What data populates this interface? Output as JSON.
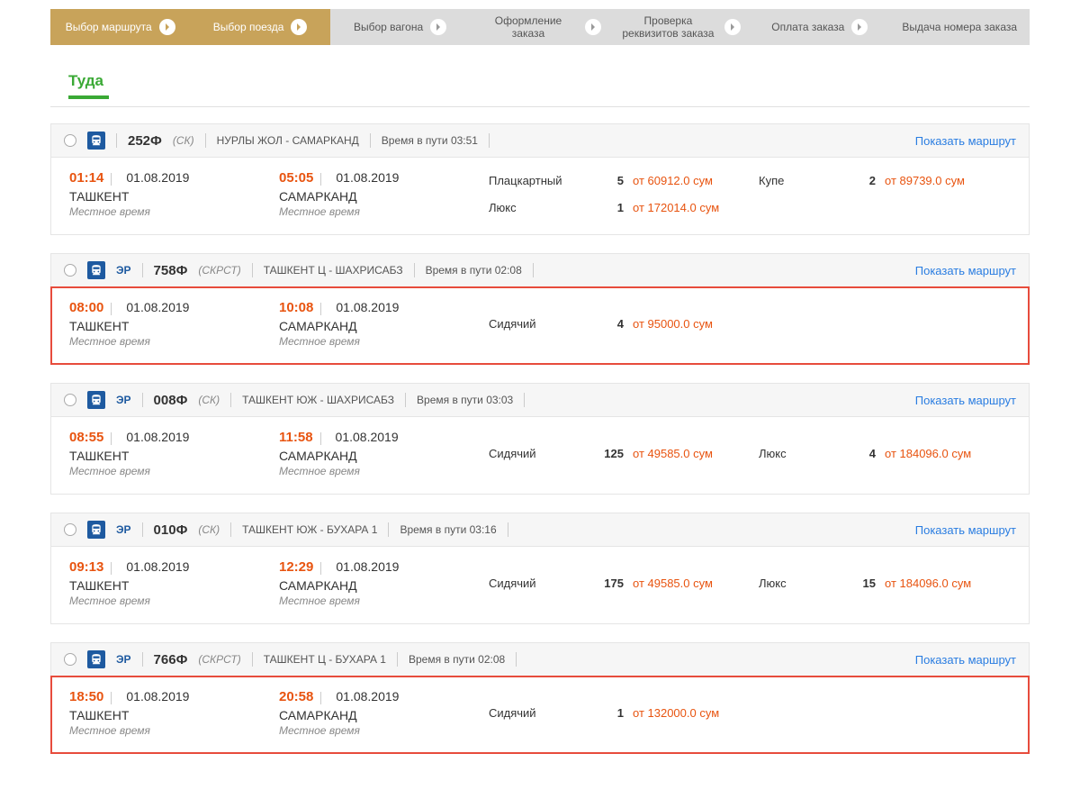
{
  "steps": [
    {
      "label": "Выбор маршрута",
      "active": true
    },
    {
      "label": "Выбор поезда",
      "active": true
    },
    {
      "label": "Выбор вагона",
      "active": false
    },
    {
      "label": "Оформление заказа",
      "active": false
    },
    {
      "label": "Проверка реквизитов заказа",
      "active": false
    },
    {
      "label": "Оплата заказа",
      "active": false
    },
    {
      "label": "Выдача номера заказа",
      "active": false
    }
  ],
  "direction_label": "Туда",
  "show_route_label": "Показать маршрут",
  "local_time_label": "Местное время",
  "travel_time_prefix": "Время в пути",
  "trains": [
    {
      "er": false,
      "number": "252Ф",
      "type": "(СК)",
      "route": "НУРЛЫ ЖОЛ - САМАРКАНД",
      "travel_time": "03:51",
      "highlighted": false,
      "dep": {
        "time": "01:14",
        "date": "01.08.2019",
        "station": "ТАШКЕНТ"
      },
      "arr": {
        "time": "05:05",
        "date": "01.08.2019",
        "station": "САМАРКАНД"
      },
      "classes": [
        {
          "name": "Плацкартный",
          "count": "5",
          "price": "от 60912.0 сум",
          "name2": "Купе",
          "count2": "2",
          "price2": "от 89739.0 сум"
        },
        {
          "name": "Люкс",
          "count": "1",
          "price": "от 172014.0 сум",
          "name2": "",
          "count2": "",
          "price2": ""
        }
      ]
    },
    {
      "er": true,
      "number": "758Ф",
      "type": "(СКРСТ)",
      "route": "ТАШКЕНТ Ц - ШАХРИСАБЗ",
      "travel_time": "02:08",
      "highlighted": true,
      "dep": {
        "time": "08:00",
        "date": "01.08.2019",
        "station": "ТАШКЕНТ"
      },
      "arr": {
        "time": "10:08",
        "date": "01.08.2019",
        "station": "САМАРКАНД"
      },
      "classes": [
        {
          "name": "Сидячий",
          "count": "4",
          "price": "от 95000.0 сум",
          "name2": "",
          "count2": "",
          "price2": ""
        }
      ]
    },
    {
      "er": true,
      "number": "008Ф",
      "type": "(СК)",
      "route": "ТАШКЕНТ ЮЖ - ШАХРИСАБЗ",
      "travel_time": "03:03",
      "highlighted": false,
      "dep": {
        "time": "08:55",
        "date": "01.08.2019",
        "station": "ТАШКЕНТ"
      },
      "arr": {
        "time": "11:58",
        "date": "01.08.2019",
        "station": "САМАРКАНД"
      },
      "classes": [
        {
          "name": "Сидячий",
          "count": "125",
          "price": "от 49585.0 сум",
          "name2": "Люкс",
          "count2": "4",
          "price2": "от 184096.0 сум"
        }
      ]
    },
    {
      "er": true,
      "number": "010Ф",
      "type": "(СК)",
      "route": "ТАШКЕНТ ЮЖ - БУХАРА 1",
      "travel_time": "03:16",
      "highlighted": false,
      "dep": {
        "time": "09:13",
        "date": "01.08.2019",
        "station": "ТАШКЕНТ"
      },
      "arr": {
        "time": "12:29",
        "date": "01.08.2019",
        "station": "САМАРКАНД"
      },
      "classes": [
        {
          "name": "Сидячий",
          "count": "175",
          "price": "от 49585.0 сум",
          "name2": "Люкс",
          "count2": "15",
          "price2": "от 184096.0 сум"
        }
      ]
    },
    {
      "er": true,
      "number": "766Ф",
      "type": "(СКРСТ)",
      "route": "ТАШКЕНТ Ц - БУХАРА 1",
      "travel_time": "02:08",
      "highlighted": true,
      "dep": {
        "time": "18:50",
        "date": "01.08.2019",
        "station": "ТАШКЕНТ"
      },
      "arr": {
        "time": "20:58",
        "date": "01.08.2019",
        "station": "САМАРКАНД"
      },
      "classes": [
        {
          "name": "Сидячий",
          "count": "1",
          "price": "от 132000.0 сум",
          "name2": "",
          "count2": "",
          "price2": ""
        }
      ]
    }
  ]
}
